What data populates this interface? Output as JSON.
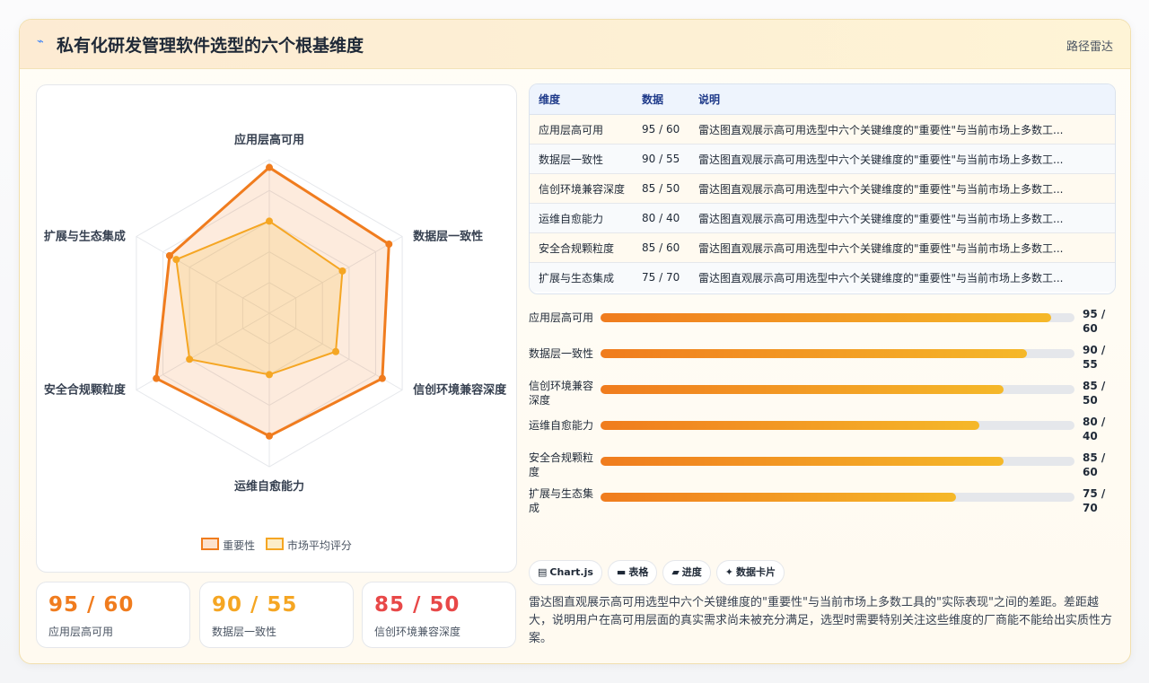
{
  "header": {
    "icon": "zigzag-icon",
    "title": "私有化研发管理软件选型的六个根基维度",
    "right_label": "路径雷达"
  },
  "chart_data": {
    "type": "radar",
    "axes": [
      "应用层高可用",
      "数据层一致性",
      "信创环境兼容深度",
      "运维自愈能力",
      "安全合规颗粒度",
      "扩展与生态集成"
    ],
    "range": [
      0,
      100
    ],
    "series": [
      {
        "name": "重要性",
        "values": [
          95,
          90,
          85,
          80,
          85,
          75
        ],
        "color": "#f07c1e"
      },
      {
        "name": "市场平均评分",
        "values": [
          60,
          55,
          50,
          40,
          60,
          70
        ],
        "color": "#f5a623"
      }
    ],
    "legend": "bottom"
  },
  "stats": [
    {
      "value": "95 / 60",
      "label": "应用层高可用",
      "color": "#f07c1e"
    },
    {
      "value": "90 / 55",
      "label": "数据层一致性",
      "color": "#f5a623"
    },
    {
      "value": "85 / 50",
      "label": "信创环境兼容深度",
      "color": "#e84848"
    }
  ],
  "table": {
    "headers": [
      "维度",
      "数据",
      "说明"
    ],
    "rows": [
      [
        "应用层高可用",
        "95 / 60",
        "雷达图直观展示高可用选型中六个关键维度的\"重要性\"与当前市场上多数工..."
      ],
      [
        "数据层一致性",
        "90 / 55",
        "雷达图直观展示高可用选型中六个关键维度的\"重要性\"与当前市场上多数工..."
      ],
      [
        "信创环境兼容深度",
        "85 / 50",
        "雷达图直观展示高可用选型中六个关键维度的\"重要性\"与当前市场上多数工..."
      ],
      [
        "运维自愈能力",
        "80 / 40",
        "雷达图直观展示高可用选型中六个关键维度的\"重要性\"与当前市场上多数工..."
      ],
      [
        "安全合规颗粒度",
        "85 / 60",
        "雷达图直观展示高可用选型中六个关键维度的\"重要性\"与当前市场上多数工..."
      ],
      [
        "扩展与生态集成",
        "75 / 70",
        "雷达图直观展示高可用选型中六个关键维度的\"重要性\"与当前市场上多数工..."
      ]
    ]
  },
  "progress": [
    {
      "label": "应用层高可用",
      "value": 95,
      "text": "95 / 60"
    },
    {
      "label": "数据层一致性",
      "value": 90,
      "text": "90 / 55"
    },
    {
      "label": "信创环境兼容深度",
      "value": 85,
      "text": "85 / 50"
    },
    {
      "label": "运维自愈能力",
      "value": 80,
      "text": "80 / 40"
    },
    {
      "label": "安全合规颗粒度",
      "value": 85,
      "text": "85 / 60"
    },
    {
      "label": "扩展与生态集成",
      "value": 75,
      "text": "75 / 70"
    }
  ],
  "tags": [
    {
      "icon": "chart-icon",
      "glyph": "▤",
      "label": "Chart.js"
    },
    {
      "icon": "table-icon",
      "glyph": "▬",
      "label": "表格"
    },
    {
      "icon": "progress-icon",
      "glyph": "▰",
      "label": "进度"
    },
    {
      "icon": "card-icon",
      "glyph": "✦",
      "label": "数据卡片"
    }
  ],
  "description": "雷达图直观展示高可用选型中六个关键维度的\"重要性\"与当前市场上多数工具的\"实际表现\"之间的差距。差距越大，说明用户在高可用层面的真实需求尚未被充分满足，选型时需要特别关注这些维度的厂商能不能给出实质性方案。"
}
